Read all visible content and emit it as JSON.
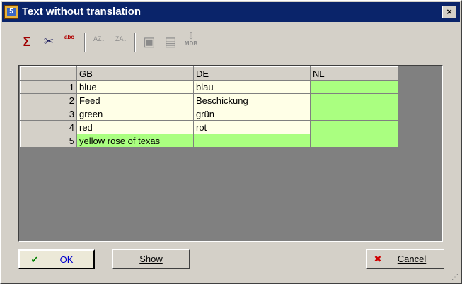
{
  "window": {
    "title": "Text without translation",
    "close_glyph": "×"
  },
  "toolbar": {
    "buttons": [
      {
        "name": "sum-icon",
        "glyph": "Σ",
        "enabled": true
      },
      {
        "name": "scissors-icon",
        "glyph": "✂",
        "enabled": true
      },
      {
        "name": "abc-spell-icon",
        "glyph": "ᵃᵇᶜ",
        "enabled": true
      },
      {
        "name": "sort-ascending-icon",
        "glyph": "↓",
        "enabled": false
      },
      {
        "name": "sort-descending-icon",
        "glyph": "↓",
        "enabled": false
      },
      {
        "name": "edit-icon",
        "glyph": "▣",
        "enabled": false
      },
      {
        "name": "save-icon",
        "glyph": "▤",
        "enabled": false
      },
      {
        "name": "mdb-export-icon",
        "glyph": "⇩",
        "enabled": false
      }
    ],
    "sort_asc_text": "AZ",
    "sort_desc_text": "ZA",
    "mdb_text": "MDB"
  },
  "grid": {
    "columns": [
      "GB",
      "DE",
      "NL"
    ],
    "rows": [
      {
        "num": "1",
        "gb": "blue",
        "de": "blau",
        "nl": ""
      },
      {
        "num": "2",
        "gb": "Feed",
        "de": "Beschickung",
        "nl": ""
      },
      {
        "num": "3",
        "gb": "green",
        "de": "grün",
        "nl": ""
      },
      {
        "num": "4",
        "gb": "red",
        "de": "rot",
        "nl": ""
      },
      {
        "num": "5",
        "gb": "yellow rose of texas",
        "de": "",
        "nl": ""
      }
    ],
    "colors": {
      "cream": "#ffffe7",
      "green": "#aaff80",
      "empty": "#808080"
    }
  },
  "buttons": {
    "ok": {
      "label": "OK",
      "icon": "✔"
    },
    "show": {
      "label": "Show"
    },
    "cancel": {
      "label": "Cancel",
      "icon": "✖"
    }
  }
}
